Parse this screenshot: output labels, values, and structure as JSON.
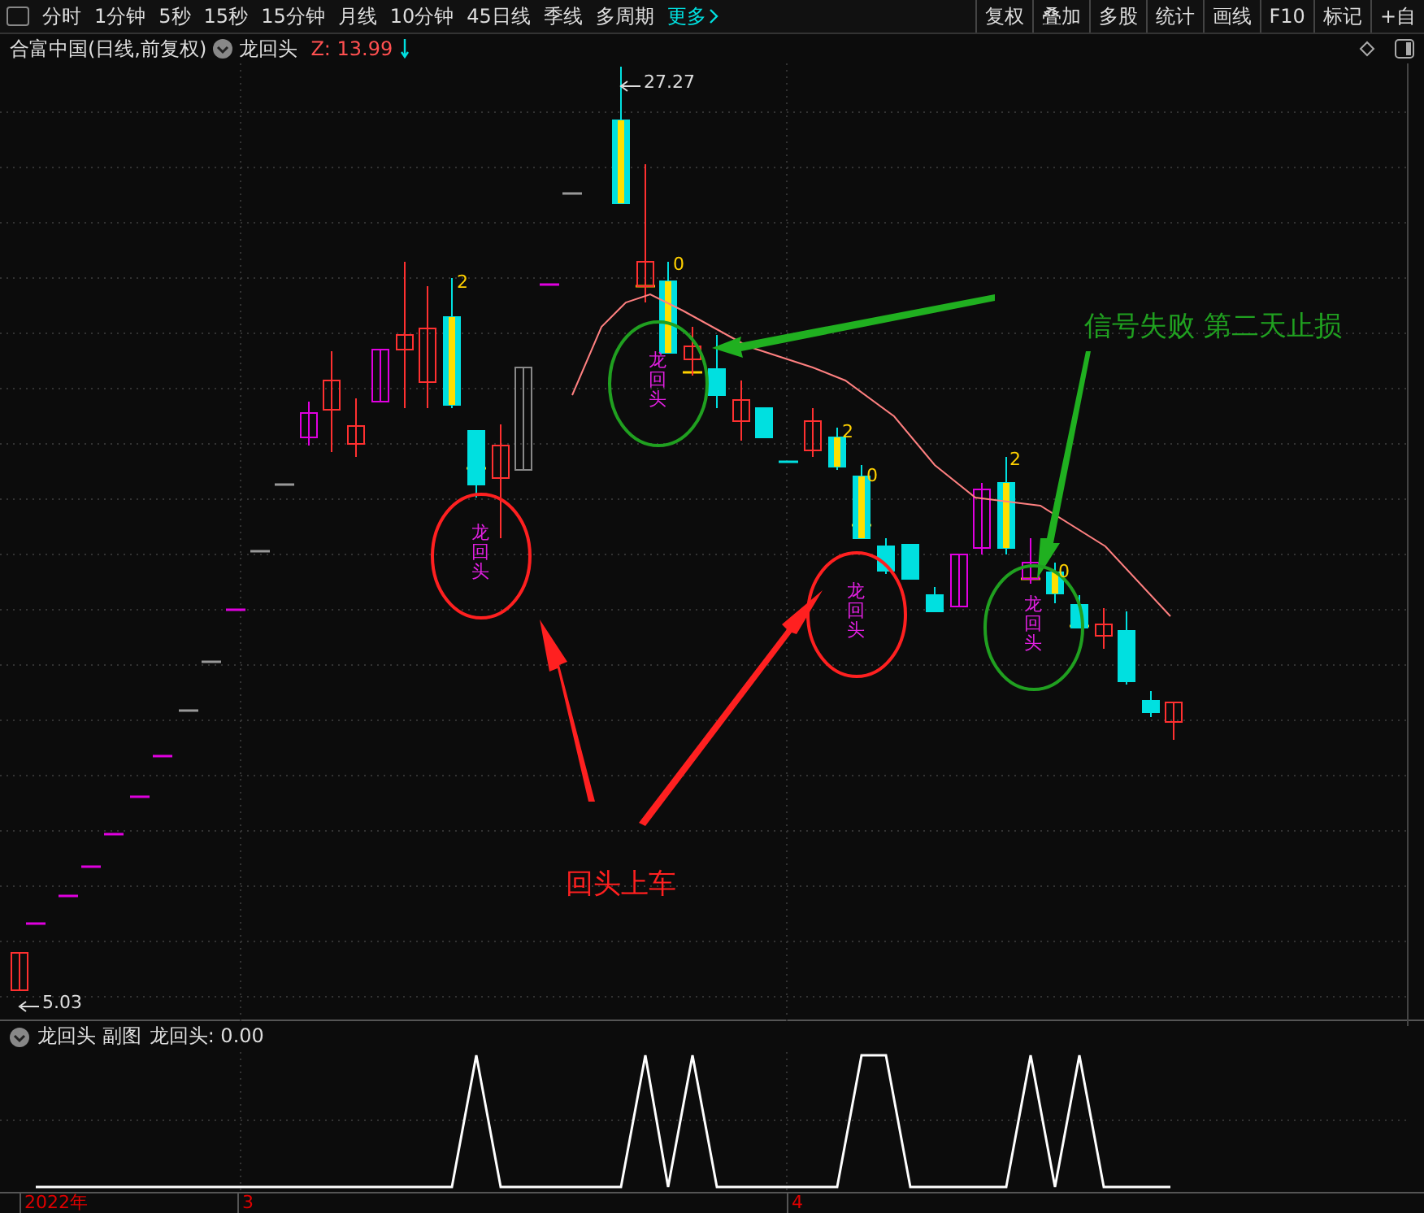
{
  "toolbar": {
    "periods": [
      {
        "label": "分时",
        "selected": false
      },
      {
        "label": "1分钟",
        "selected": false
      },
      {
        "label": "5秒",
        "selected": false
      },
      {
        "label": "15秒",
        "selected": false
      },
      {
        "label": "15分钟",
        "selected": false
      },
      {
        "label": "月线",
        "selected": false
      },
      {
        "label": "10分钟",
        "selected": false
      },
      {
        "label": "45日线",
        "selected": false
      },
      {
        "label": "季线",
        "selected": false
      },
      {
        "label": "多周期",
        "selected": false
      }
    ],
    "more": "更多",
    "actions": [
      "复权",
      "叠加",
      "多股",
      "统计",
      "画线",
      "F10",
      "标记",
      "+自"
    ]
  },
  "header": {
    "stock": "合富中国(日线,前复权)",
    "indicator": "龙回头",
    "value": "Z: 13.99"
  },
  "chart": {
    "labels": [
      {
        "kind": "price",
        "text": "27.27"
      },
      {
        "kind": "price",
        "text": "5.03"
      },
      {
        "kind": "signal",
        "text": "2"
      },
      {
        "kind": "signal",
        "text": "0"
      },
      {
        "kind": "signal",
        "text": "2"
      },
      {
        "kind": "signal",
        "text": "0"
      },
      {
        "kind": "signal",
        "text": "2"
      },
      {
        "kind": "signal",
        "text": "0"
      }
    ],
    "circles": [
      {
        "color": "#ff2020",
        "text": "龙回头"
      },
      {
        "color": "#20a020",
        "text": "龙回头"
      },
      {
        "color": "#ff2020",
        "text": "龙回头"
      },
      {
        "color": "#20a020",
        "text": "龙回头"
      }
    ],
    "callouts": [
      {
        "color": "#20a020",
        "text": "信号失败 第二天止损"
      },
      {
        "color": "#ff2020",
        "text": "回头上车"
      }
    ]
  },
  "sub_chart": {
    "title": "龙回头 副图",
    "value": "龙回头: 0.00"
  },
  "date_axis": [
    "2022年",
    "3",
    "4"
  ]
}
